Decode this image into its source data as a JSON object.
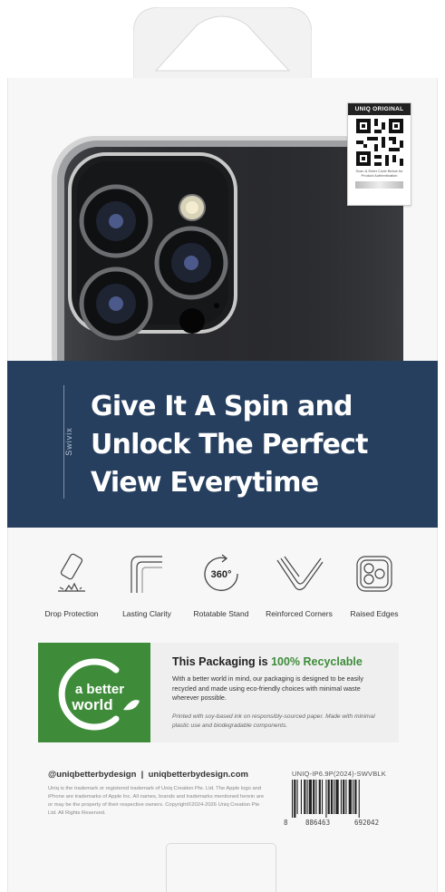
{
  "qr": {
    "header": "UNIQ ORIGINAL",
    "subtext": "Scan & Enter Code Below for Product Authentication"
  },
  "banner": {
    "brand": "Swivix",
    "headline": [
      "Give It A Spin and",
      "Unlock The Perfect",
      "View Everytime"
    ]
  },
  "features": [
    {
      "icon": "drop-protection-icon",
      "label": "Drop Protection"
    },
    {
      "icon": "lasting-clarity-icon",
      "label": "Lasting Clarity"
    },
    {
      "icon": "rotatable-stand-icon",
      "label": "Rotatable Stand",
      "icon_text": "360°"
    },
    {
      "icon": "reinforced-corners-icon",
      "label": "Reinforced Corners"
    },
    {
      "icon": "raised-edges-icon",
      "label": "Raised Edges"
    }
  ],
  "recycle": {
    "logo_line1": "a better",
    "logo_line2": "world",
    "title_prefix": "This Packaging is ",
    "title_highlight": "100% Recyclable",
    "body": "With a better world in mind, our packaging is designed to be easily recycled and made using eco-friendly choices with minimal waste wherever possible.",
    "note": "Printed with soy-based ink on responsibly-sourced paper. Made with minimal plastic use and biodegradable components.",
    "accent_color": "#3e8c3a"
  },
  "footer": {
    "social": "@uniqbetterbydesign  |  uniqbetterbydesign.com",
    "legal": "Uniq is the trademark or registered trademark of Uniq Creation Pte. Ltd. The Apple logo and iPhone are trademarks of Apple Inc. All names, brands and trademarks mentioned herein are or may be the property of their respective owners. Copyright©2024-2026 Uniq Creation Pte Ltd. All Rights Reserved.",
    "sku": "UNIQ-IP6.9P(2024)-SWVBLK",
    "barcode_digits": [
      "8",
      "886463",
      "692042"
    ]
  },
  "colors": {
    "banner": "#263f5f",
    "green": "#3e8c3a"
  }
}
